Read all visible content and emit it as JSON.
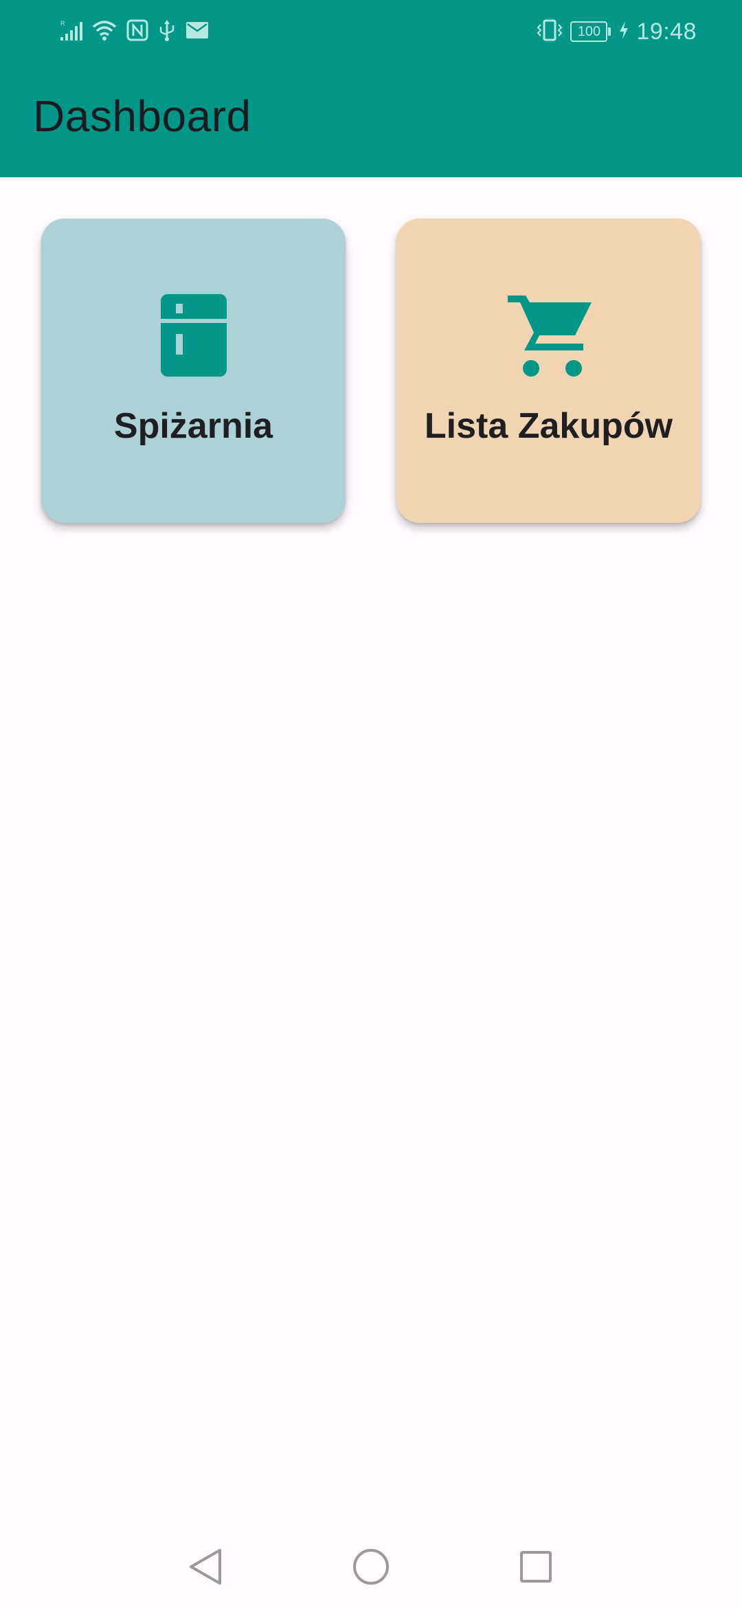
{
  "status_bar": {
    "time": "19:48",
    "battery_level": "100",
    "icons_left": [
      "signal-icon",
      "wifi-icon",
      "nfc-icon",
      "usb-icon",
      "mail-icon"
    ],
    "icons_right": [
      "vibrate-icon",
      "battery-icon",
      "charging-icon"
    ]
  },
  "header": {
    "title": "Dashboard",
    "color": "#009688"
  },
  "tiles": [
    {
      "label": "Spiżarnia",
      "icon": "fridge-icon",
      "background": "#ACD2D7",
      "icon_color": "#009688"
    },
    {
      "label": "Lista Zakupów",
      "icon": "shopping-cart-icon",
      "background": "#F1D4B1",
      "icon_color": "#009688"
    }
  ],
  "nav_bar": {
    "buttons": [
      "back",
      "home",
      "recent-apps"
    ]
  }
}
